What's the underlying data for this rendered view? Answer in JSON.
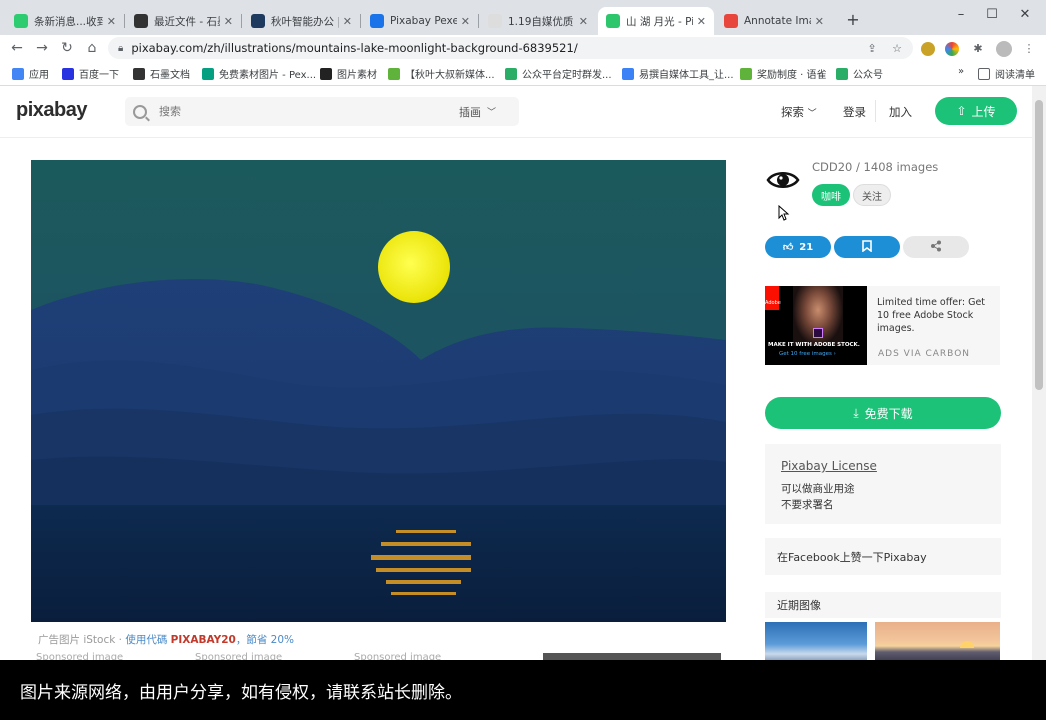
{
  "browser": {
    "tabs": [
      {
        "title": "条新消息...收到",
        "color": "#2ecc71",
        "icon": "feed-icon"
      },
      {
        "title": "最近文件 - 石墨",
        "color": "#333333",
        "icon": "shimo-icon"
      },
      {
        "title": "秋叶智能办公 |",
        "color": "#1e3a5f",
        "icon": "qiuye-icon"
      },
      {
        "title": "Pixabay Pexels",
        "color": "#1a73e8",
        "icon": "zhihu-icon"
      },
      {
        "title": "1.19自媒优质",
        "color": "#dddddd",
        "icon": "doc-icon"
      },
      {
        "title": "山 湖 月光 - Pix",
        "color": "#2ec66d",
        "icon": "pixabay-icon"
      },
      {
        "title": "Annotate Imag",
        "color": "#e8453c",
        "icon": "chrome-icon"
      }
    ],
    "url": "pixabay.com/zh/illustrations/mountains-lake-moonlight-background-6839521/",
    "bookmarks": [
      {
        "label": "应用",
        "color": "#4285f4"
      },
      {
        "label": "百度一下",
        "color": "#2932e1"
      },
      {
        "label": "石墨文档",
        "color": "#333333"
      },
      {
        "label": "免费素材图片 - Pex...",
        "color": "#05a081"
      },
      {
        "label": "图片素材",
        "color": "#222222"
      },
      {
        "label": "【秋叶大叔新媒体...",
        "color": "#5fb33a"
      },
      {
        "label": "公众平台定时群发...",
        "color": "#2aae67"
      },
      {
        "label": "易撰自媒体工具_让...",
        "color": "#3b82f6"
      },
      {
        "label": "奖励制度 · 语雀",
        "color": "#5fb33a"
      },
      {
        "label": "公众号",
        "color": "#2aae67"
      }
    ],
    "reading_list": "阅读清单"
  },
  "site": {
    "logo": "pixabay",
    "search_placeholder": "搜索",
    "filter_label": "插画",
    "explore_label": "探索",
    "login_label": "登录",
    "join_label": "加入",
    "upload_label": "上传"
  },
  "main": {
    "ad_prefix": "广告图片 iStock · ",
    "ad_use_code": "使用代碼 ",
    "ad_code": "PIXABAY20",
    "ad_suffix": "，節省 20%",
    "sponsored": [
      "Sponsored image",
      "Sponsored image",
      "Sponsored image"
    ]
  },
  "sidebar": {
    "author": "CDD20 / 1408 images",
    "coffee_label": "咖啡",
    "follow_label": "关注",
    "likes": "21",
    "ad_text": "Limited time offer: Get 10 free Adobe Stock images.",
    "ad_banner_line1": "MAKE IT WITH ADOBE STOCK.",
    "ad_banner_line2": "Get 10 free images ›",
    "ad_adobe": "Adobe",
    "ads_via": "ADS VIA CARBON",
    "download_label": "免费下载",
    "license_title": "Pixabay License",
    "license_line1": "可以做商业用途",
    "license_line2": "不要求署名",
    "facebook_text": "在Facebook上赞一下Pixabay",
    "recent_title": "近期图像"
  },
  "overlay": {
    "caption": "图片来源网络，由用户分享，如有侵权，请联系站长删除。"
  }
}
